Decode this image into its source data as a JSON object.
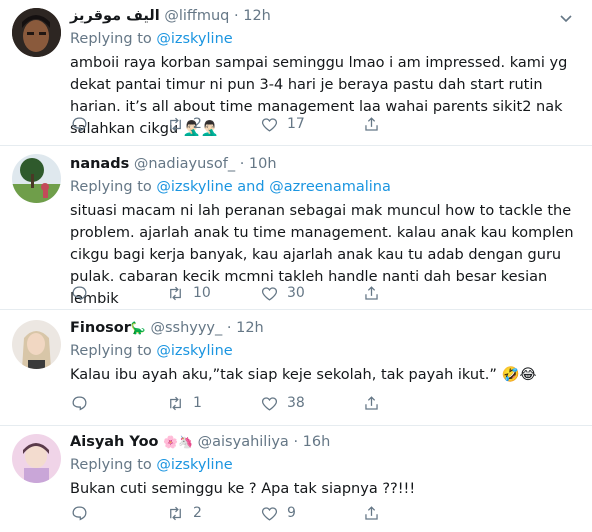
{
  "tweets": [
    {
      "name": "اليف موقريز",
      "name_emoji": "",
      "handle": "@liffmuq",
      "dot": "·",
      "time": "12h",
      "replying_prefix": "Replying to",
      "replying_to": [
        "@izskyline"
      ],
      "replying_joiner": "",
      "text": "amboii raya korban sampai seminggu lmao i am impressed. kami yg dekat pantai timur ni pun 3-4 hari je beraya pastu dah start rutin harian. it’s all about time management laa wahai parents sikit2 nak salahkan cikgu 🤦🏻‍♂️🤦🏻‍♂️",
      "replies": "",
      "retweets": "2",
      "likes": "17"
    },
    {
      "name": "nanads",
      "name_emoji": "",
      "handle": "@nadiayusof_",
      "dot": "·",
      "time": "10h",
      "replying_prefix": "Replying to",
      "replying_to": [
        "@izskyline",
        "@azreenamalina"
      ],
      "replying_joiner": "and",
      "text": "situasi macam ni lah peranan sebagai mak muncul how to tackle the problem. ajarlah anak tu time management. kalau anak kau komplen cikgu bagi kerja banyak, kau ajarlah anak kau tu adab dengan guru pulak. cabaran kecik mcmni takleh handle nanti dah besar kesian lembik",
      "replies": "",
      "retweets": "10",
      "likes": "30"
    },
    {
      "name": "Finosor",
      "name_emoji": "🦕",
      "handle": "@sshyyy_",
      "dot": "·",
      "time": "12h",
      "replying_prefix": "Replying to",
      "replying_to": [
        "@izskyline"
      ],
      "replying_joiner": "",
      "text": "Kalau ibu ayah aku,”tak siap keje sekolah, tak payah ikut.” 🤣😂",
      "replies": "",
      "retweets": "1",
      "likes": "38"
    },
    {
      "name": "Aisyah Yoo",
      "name_emoji": "🌸🦄",
      "handle": "@aisyahiliya",
      "dot": "·",
      "time": "16h",
      "replying_prefix": "Replying to",
      "replying_to": [
        "@izskyline"
      ],
      "replying_joiner": "",
      "text": "Bukan cuti seminggu ke ? Apa tak siapnya ??!!!",
      "replies": "",
      "retweets": "2",
      "likes": "9"
    }
  ]
}
